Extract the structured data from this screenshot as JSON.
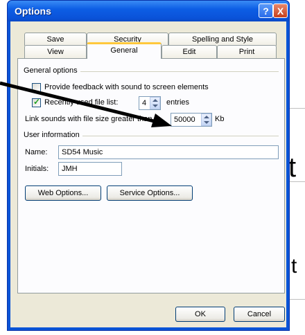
{
  "window": {
    "title": "Options",
    "help_glyph": "?",
    "close_glyph": "X"
  },
  "tabs": {
    "row_back": [
      "Save",
      "Security",
      "Spelling and Style"
    ],
    "row_front": [
      "View",
      "General",
      "Edit",
      "Print"
    ],
    "active": "General"
  },
  "general_options": {
    "heading": "General options",
    "feedback_sound_label": "Provide feedback with sound to screen elements",
    "feedback_sound_checked": false,
    "recently_used_label": "Recently used file list:",
    "recently_used_checked": true,
    "recently_used_value": "4",
    "entries_label": "entries",
    "link_sounds_label": "Link sounds with file size greater than",
    "link_sounds_value": "50000",
    "kb_label": "Kb"
  },
  "user_information": {
    "heading": "User information",
    "name_label": "Name:",
    "name_value": "SD54 Music",
    "initials_label": "Initials:",
    "initials_value": "JMH"
  },
  "buttons": {
    "web_options": "Web Options...",
    "service_options": "Service Options...",
    "ok": "OK",
    "cancel": "Cancel"
  },
  "background": {
    "letter_1": "t",
    "letter_2": "t"
  },
  "annotation": {
    "arrow_color": "#000000"
  }
}
